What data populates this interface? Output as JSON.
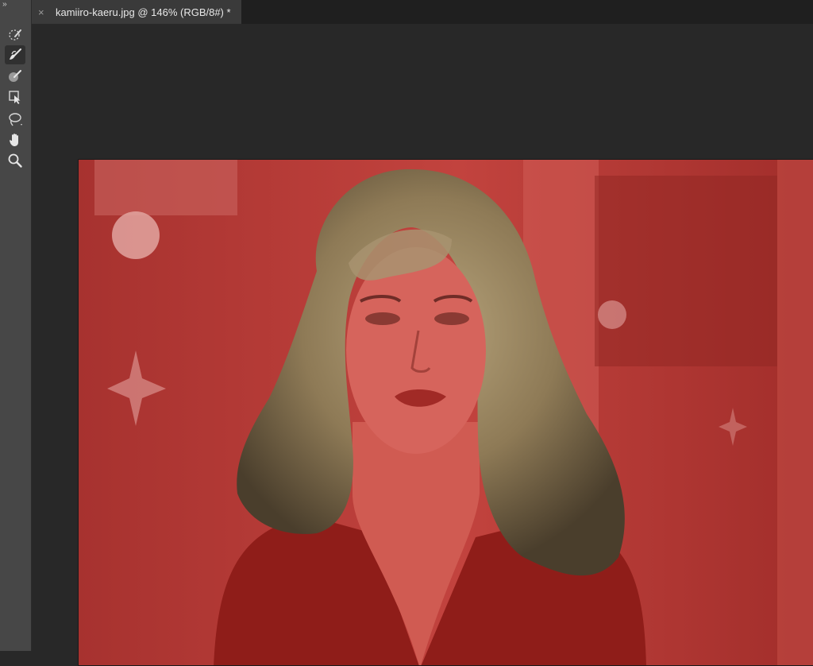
{
  "toolbar": {
    "collapse_glyph": "››",
    "tools": [
      {
        "name": "quick-selection-tool-icon",
        "active": false
      },
      {
        "name": "brush-tool-icon",
        "active": true
      },
      {
        "name": "refine-edge-brush-icon",
        "active": false
      },
      {
        "name": "object-selection-tool-icon",
        "active": false
      },
      {
        "name": "lasso-tool-icon",
        "active": false
      },
      {
        "name": "hand-tool-icon",
        "active": false
      },
      {
        "name": "zoom-tool-icon",
        "active": false
      }
    ]
  },
  "document": {
    "tab_close": "×",
    "tab_title": "kamiiro-kaeru.jpg @ 146% (RGB/8#) *"
  },
  "colors": {
    "overlay_red": "#b0312d",
    "panel": "#474747",
    "workspace": "#282828",
    "tab_bg": "#3a3a3a"
  }
}
